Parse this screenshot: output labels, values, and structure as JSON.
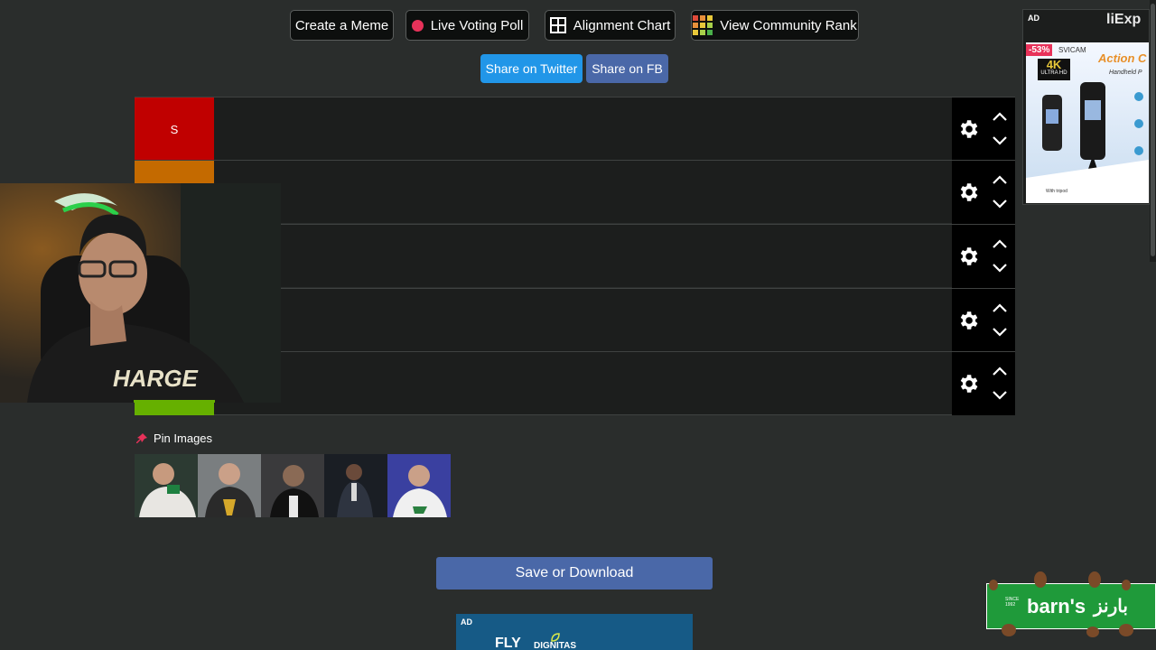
{
  "toolbar": {
    "create_meme": "Create a Meme",
    "live_voting": "Live Voting Poll",
    "alignment_chart": "Alignment Chart",
    "community_rank": "View Community Rank"
  },
  "share": {
    "twitter": "Share on Twitter",
    "facebook": "Share on FB"
  },
  "tiers": [
    {
      "label": "S",
      "color": "#c00000"
    },
    {
      "label": "",
      "color": "#c46a00"
    },
    {
      "label": "",
      "color": "#c8a800"
    },
    {
      "label": "",
      "color": "#a9c400"
    },
    {
      "label": "",
      "color": "#66b000"
    }
  ],
  "pin_images": {
    "title": "Pin Images",
    "count": 5
  },
  "save_button": "Save or Download",
  "ads": {
    "right": {
      "tag": "AD",
      "brand": "liExp",
      "discount": "-53%",
      "badge": "4K",
      "badge_sub": "ULTRA HD",
      "product": "Action C",
      "subtitle": "Handheld P",
      "caption": "With tripod",
      "model": "SVICAM"
    },
    "bottom": {
      "tag": "AD",
      "text1": "FLY",
      "text2": "DIGNITAS"
    },
    "corner": {
      "brand": "barn's",
      "brand_ar": "بارنز",
      "small": "SINCE 1992"
    }
  },
  "colors": {
    "twitter": "#1da1f2",
    "facebook": "#4a68a8",
    "accent_red": "#e8325a"
  }
}
